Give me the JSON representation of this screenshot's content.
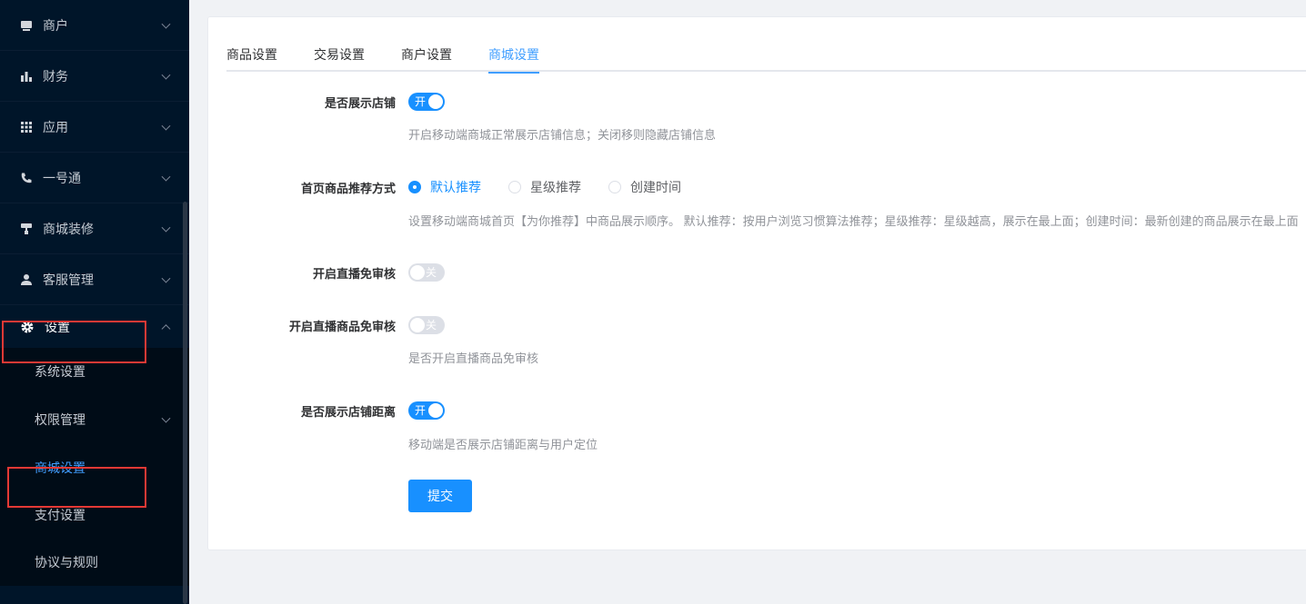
{
  "sidebar": {
    "items": [
      {
        "label": "商户",
        "icon": "store-icon"
      },
      {
        "label": "财务",
        "icon": "bar-chart-icon"
      },
      {
        "label": "应用",
        "icon": "grid-icon"
      },
      {
        "label": "一号通",
        "icon": "phone-icon"
      },
      {
        "label": "商城装修",
        "icon": "paint-roller-icon"
      },
      {
        "label": "客服管理",
        "icon": "user-icon"
      },
      {
        "label": "设置",
        "icon": "gear-icon"
      }
    ],
    "submenu": [
      {
        "label": "系统设置"
      },
      {
        "label": "权限管理"
      },
      {
        "label": "商城设置"
      },
      {
        "label": "支付设置"
      },
      {
        "label": "协议与规则"
      }
    ]
  },
  "tabs": [
    "商品设置",
    "交易设置",
    "商户设置",
    "商城设置"
  ],
  "active_tab": "商城设置",
  "form": {
    "show_store": {
      "label": "是否展示店铺",
      "switch_text": "开",
      "on": true,
      "hint": "开启移动端商城正常展示店铺信息；关闭移则隐藏店铺信息"
    },
    "recommend": {
      "label": "首页商品推荐方式",
      "options": [
        "默认推荐",
        "星级推荐",
        "创建时间"
      ],
      "selected": "默认推荐",
      "hint": "设置移动端商城首页【为你推荐】中商品展示顺序。 默认推荐：按用户浏览习惯算法推荐；星级推荐：星级越高，展示在最上面；创建时间：最新创建的商品展示在最上面"
    },
    "live_audit": {
      "label": "开启直播免审核",
      "switch_text": "关",
      "on": false
    },
    "live_goods_audit": {
      "label": "开启直播商品免审核",
      "switch_text": "关",
      "on": false,
      "hint": "是否开启直播商品免审核"
    },
    "show_distance": {
      "label": "是否展示店铺距离",
      "switch_text": "开",
      "on": true,
      "hint": "移动端是否展示店铺距离与用户定位"
    },
    "submit_label": "提交"
  },
  "colors": {
    "sidebar_bg": "#001529",
    "accent": "#1890ff",
    "highlight": "#e53935"
  }
}
